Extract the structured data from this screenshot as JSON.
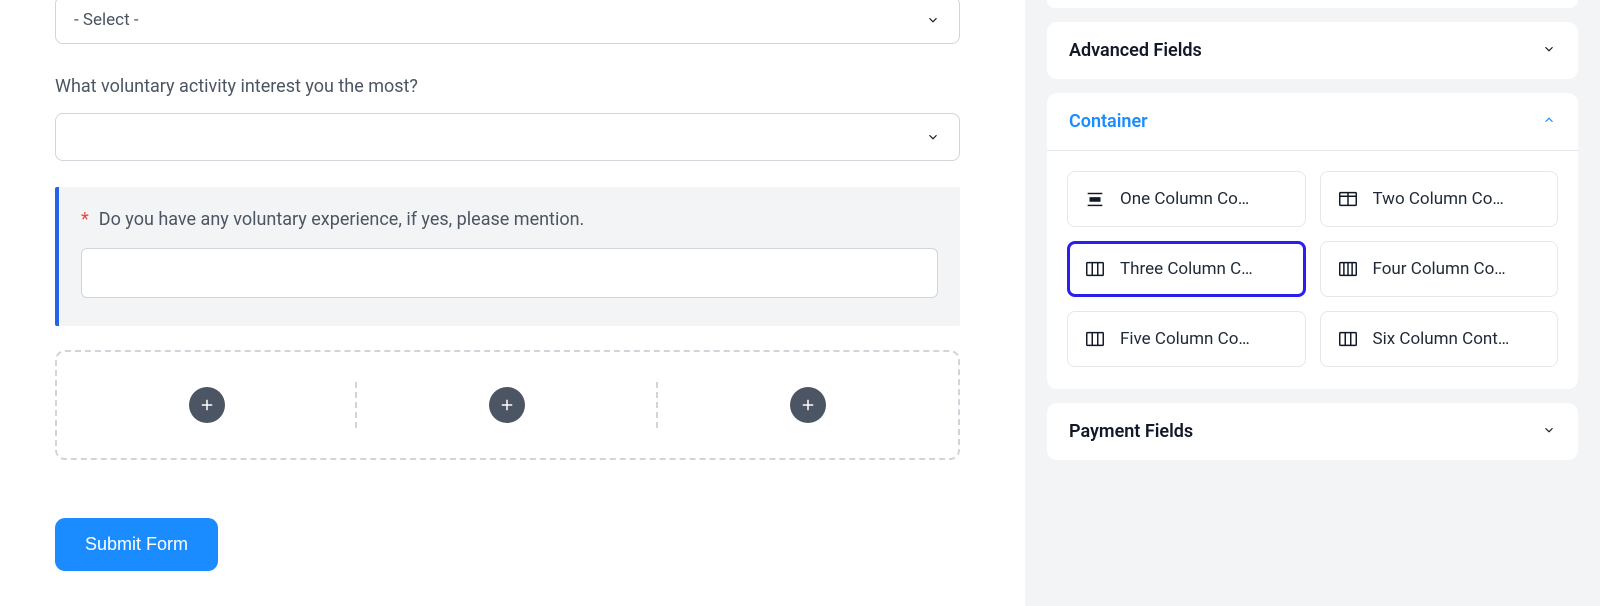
{
  "form": {
    "select1": {
      "placeholder": "- Select -",
      "value": ""
    },
    "label_activity": "What voluntary activity interest you the most?",
    "select2": {
      "placeholder": "",
      "value": ""
    },
    "highlighted": {
      "required_marker": "*",
      "label": "Do you have any voluntary experience, if yes, please mention.",
      "value": ""
    },
    "submit_label": "Submit Form"
  },
  "sidebar": {
    "sections": {
      "advanced": {
        "title": "Advanced Fields",
        "expanded": false
      },
      "container": {
        "title": "Container",
        "expanded": true,
        "items": [
          {
            "label": "One Column Co…"
          },
          {
            "label": "Two Column Co…"
          },
          {
            "label": "Three Column C…"
          },
          {
            "label": "Four Column Co…"
          },
          {
            "label": "Five Column Co…"
          },
          {
            "label": "Six Column Cont…"
          }
        ],
        "selected_index": 2
      },
      "payment": {
        "title": "Payment Fields",
        "expanded": false
      }
    }
  }
}
